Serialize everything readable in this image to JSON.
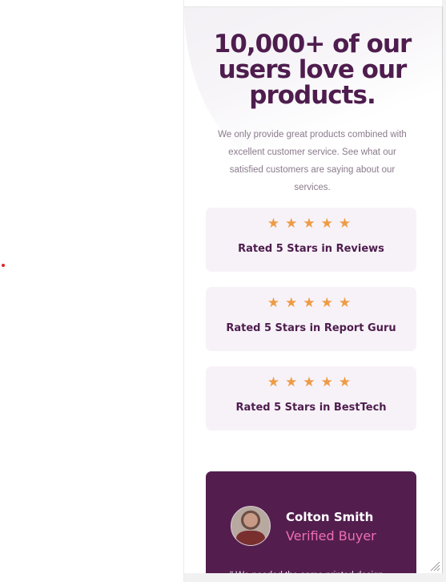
{
  "headline": "10,000+ of our users love our products.",
  "intro": "We only provide great products combined with excellent customer service. See what our satisfied customers are saying about our services.",
  "ratings": [
    {
      "stars": 5,
      "label": "Rated 5 Stars in Reviews"
    },
    {
      "stars": 5,
      "label": "Rated 5 Stars in Report Guru"
    },
    {
      "stars": 5,
      "label": "Rated 5 Stars in BestTech"
    }
  ],
  "testimonial": {
    "name": "Colton Smith",
    "role": "Verified Buyer",
    "quote": "\" We needed the same printed design"
  },
  "colors": {
    "primary": "#4e1d4e",
    "accent_star": "#ee9b45",
    "accent_pink": "#ee6fb3",
    "card_bg": "#f7f2f8",
    "testimonial_bg": "#531e4e"
  },
  "icons": {
    "star": "star-icon",
    "resize": "resize-grip-icon"
  }
}
